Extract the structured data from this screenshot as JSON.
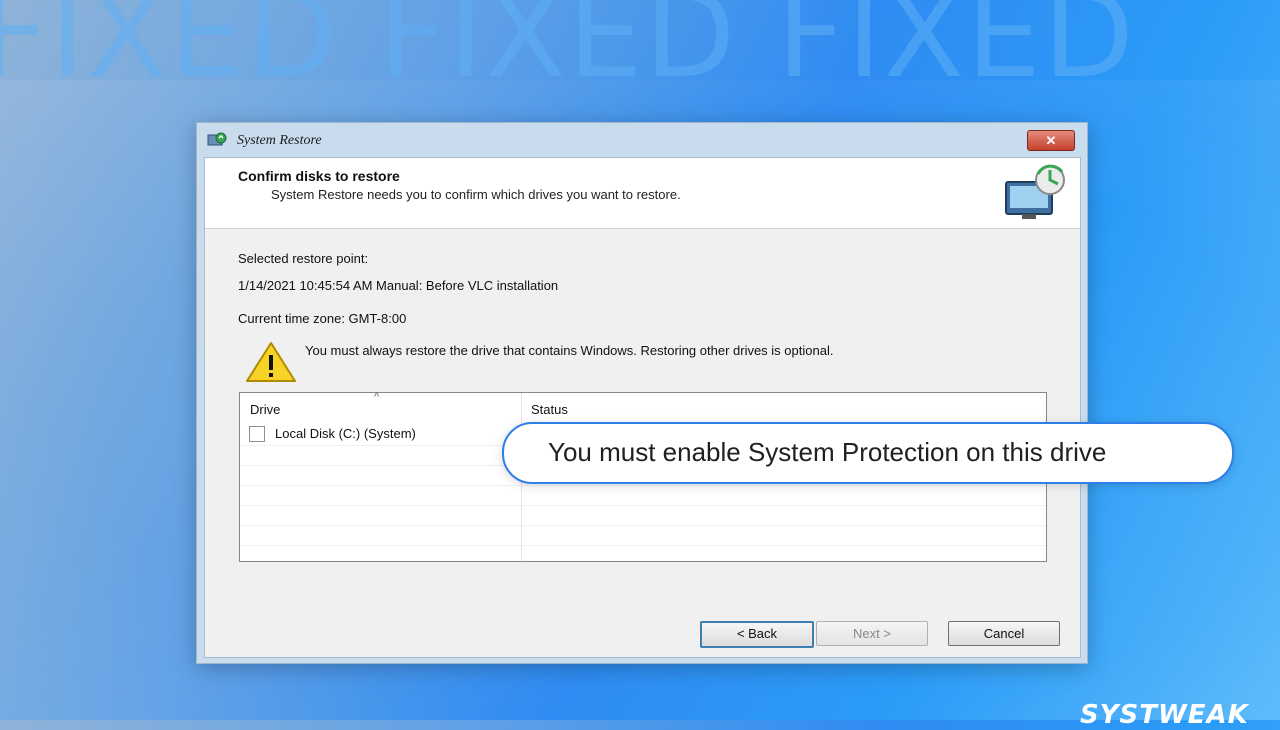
{
  "background": {
    "watermark_text": "FIXED FIXED FIXED",
    "gradient_colors": [
      "#8fb3d8",
      "#2f8cf2",
      "#57b9fb"
    ]
  },
  "window": {
    "title": "System Restore",
    "close_label": "✕",
    "header": {
      "title": "Confirm disks to restore",
      "subtitle": "System Restore needs you to confirm which drives you want to restore."
    },
    "selected_label": "Selected restore point:",
    "restore_point": "1/14/2021 10:45:54 AM Manual: Before VLC installation",
    "timezone": "Current time zone: GMT-8:00",
    "warning": "You must always restore the drive that contains Windows. Restoring other drives is optional.",
    "table": {
      "columns": [
        "Drive",
        "Status"
      ],
      "rows": [
        {
          "drive": "Local Disk (C:) (System)",
          "checked": false
        }
      ]
    },
    "buttons": {
      "back": "< Back",
      "next": "Next >",
      "cancel": "Cancel"
    }
  },
  "callout": "You must enable System Protection on this drive",
  "brand": "SYSTWEAK",
  "colors": {
    "accent": "#2f7fe6",
    "close_red": "#c4402c"
  },
  "icons": [
    "system-restore-icon",
    "warning-icon",
    "computer-restore-icon"
  ]
}
